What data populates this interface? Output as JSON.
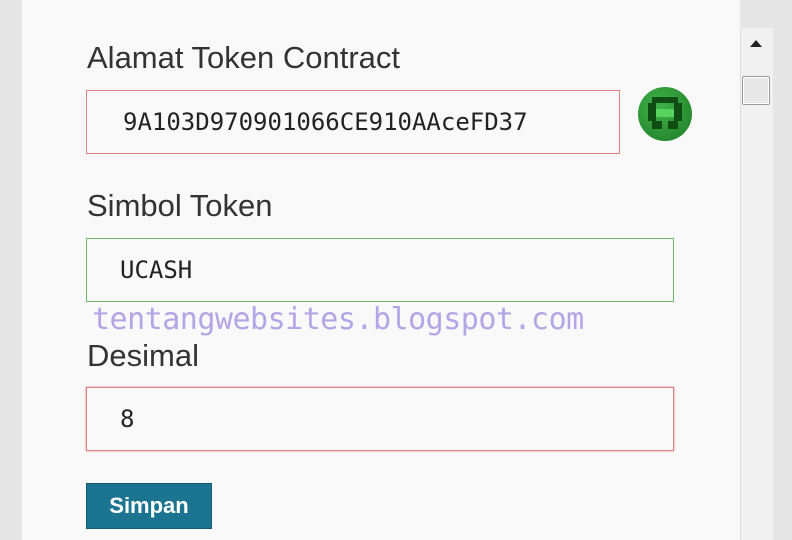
{
  "form": {
    "contract_label": "Alamat Token Contract",
    "contract_value": "9A103D970901066CE910AAceFD37",
    "symbol_label": "Simbol Token",
    "symbol_value": "UCASH",
    "decimals_label": "Desimal",
    "decimals_value": "8",
    "save_label": "Simpan"
  },
  "watermark": "tentangwebsites.blogspot.com",
  "colors": {
    "error_border": "#e58080",
    "ok_border": "#6cbf6c",
    "button": "#1b7490",
    "watermark": "#b3a6e6"
  },
  "icons": {
    "token_identicon": "green-identicon"
  }
}
